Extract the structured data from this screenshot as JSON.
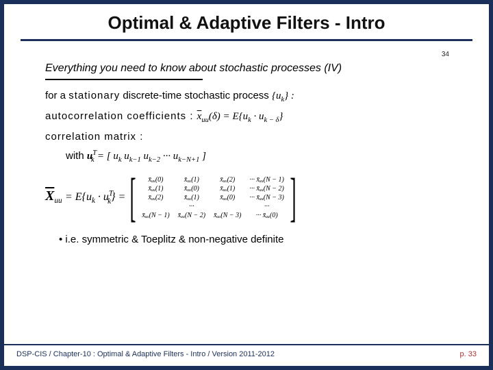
{
  "title": "Optimal & Adaptive Filters - Intro",
  "pagelet": "34",
  "heading_italic": "Everything you need to know about stochastic processes (IV)",
  "for_line_a": "for a ",
  "for_line_b": "stationary",
  "for_line_c": " discrete-time stochastic process ",
  "for_line_d": "{u",
  "for_line_e": "k",
  "for_line_f": "}  :",
  "ac_label": "autocorrelation coefficients : ",
  "ac_lhs_bar": "x",
  "ac_lhs_sub": "uu",
  "ac_lhs_arg": "(δ) = ",
  "ac_rhs_a": "E{u",
  "ac_rhs_b": "k",
  "ac_rhs_c": " · u",
  "ac_rhs_d": "k − δ",
  "ac_rhs_e": "}",
  "cm_label": "correlation matrix :",
  "with_label": "with  ",
  "vec_a": "u",
  "vec_b": "T",
  "vec_c": "k",
  "vec_eq": " = [ u",
  "vec_1": "k",
  "vec_sp1": " u",
  "vec_2": "k−1",
  "vec_sp2": " u",
  "vec_3": "k−2",
  "vec_dots": " ··· u",
  "vec_4": "k−N+1",
  "vec_end": " ]",
  "lhs_bar": "X",
  "lhs_sub": "uu",
  "lhs_eq": " = E{u",
  "lhs_k": "k",
  "lhs_dot": " · u",
  "lhs_T": "T",
  "lhs_k2": "k",
  "lhs_close": "} = ",
  "mat": {
    "r0": [
      "x̄ᵤᵤ(0)",
      "x̄ᵤᵤ(1)",
      "x̄ᵤᵤ(2)",
      "···  x̄ᵤᵤ(N − 1)"
    ],
    "r1": [
      "x̄ᵤᵤ(1)",
      "x̄ᵤᵤ(0)",
      "x̄ᵤᵤ(1)",
      "···  x̄ᵤᵤ(N − 2)"
    ],
    "r2": [
      "x̄ᵤᵤ(2)",
      "x̄ᵤᵤ(1)",
      "x̄ᵤᵤ(0)",
      "···  x̄ᵤᵤ(N − 3)"
    ],
    "r3": [
      "",
      "···",
      "",
      "···"
    ],
    "r4": [
      "x̄ᵤᵤ(N − 1)",
      "x̄ᵤᵤ(N − 2)",
      "x̄ᵤᵤ(N − 3)",
      "···  x̄ᵤᵤ(0)"
    ]
  },
  "bullet": "•   i.e. symmetric & Toeplitz & non-negative definite",
  "footer_left": "DSP-CIS  /  Chapter-10 : Optimal & Adaptive Filters - Intro  /  Version 2011-2012",
  "footer_right": "p. 33"
}
